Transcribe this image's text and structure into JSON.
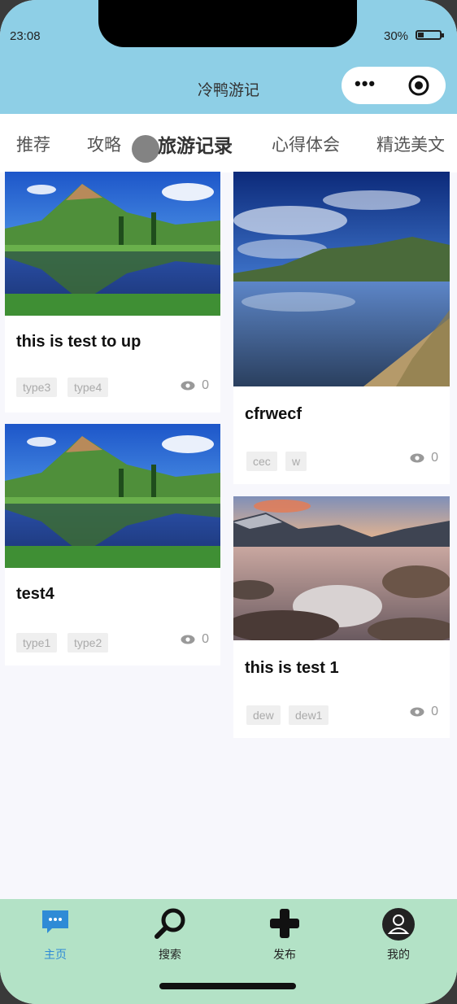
{
  "status": {
    "time": "23:08",
    "battery": "30%"
  },
  "nav": {
    "title": "冷鸭游记"
  },
  "tabs": [
    {
      "label": "推荐",
      "active": false
    },
    {
      "label": "攻略",
      "active": false
    },
    {
      "label": "旅游记录",
      "active": true
    },
    {
      "label": "心得体会",
      "active": false
    },
    {
      "label": "精选美文",
      "active": false
    }
  ],
  "cards": [
    {
      "title": "this is test to up",
      "tags": [
        "type3",
        "type4"
      ],
      "views": "0"
    },
    {
      "title": "cfrwecf",
      "tags": [
        "cec",
        "w"
      ],
      "views": "0"
    },
    {
      "title": "test4",
      "tags": [
        "type1",
        "type2"
      ],
      "views": "0"
    },
    {
      "title": "this is test 1",
      "tags": [
        "dew",
        "dew1"
      ],
      "views": "0"
    }
  ],
  "bottom_nav": [
    {
      "label": "主页",
      "icon": "chat-bubble-icon",
      "active": true
    },
    {
      "label": "搜索",
      "icon": "search-icon",
      "active": false
    },
    {
      "label": "发布",
      "icon": "plus-icon",
      "active": false
    },
    {
      "label": "我的",
      "icon": "user-icon",
      "active": false
    }
  ],
  "colors": {
    "header": "#8ecfe6",
    "tabbar": "#b3e2c6",
    "accent": "#2f8bd6"
  }
}
